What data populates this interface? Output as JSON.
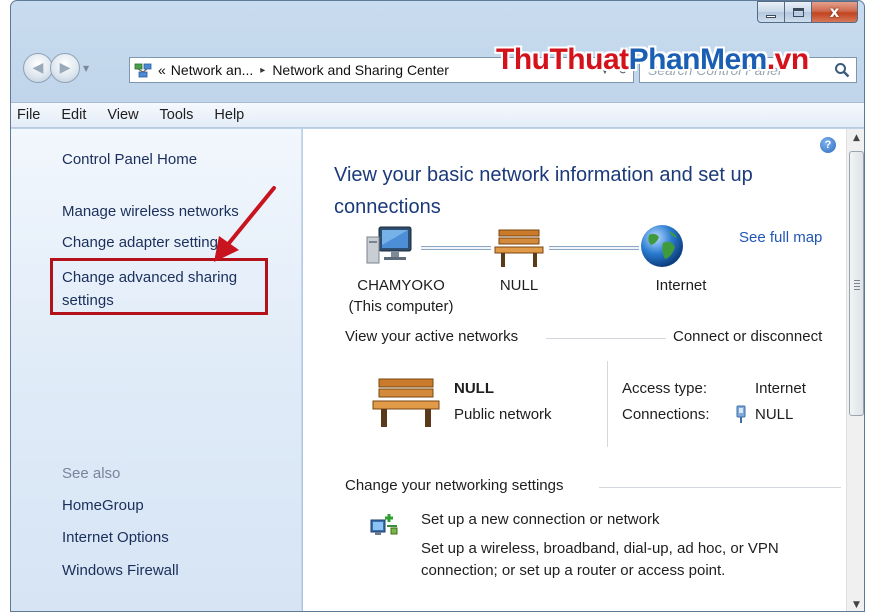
{
  "window": {
    "close_glyph": "x"
  },
  "address": {
    "chevron": "«",
    "crumb1": "Network an...",
    "separator": "▸",
    "crumb2": "Network and Sharing Center",
    "search_placeholder": "Search Control Panel"
  },
  "watermark": {
    "part1": "ThuThuat",
    "part2": "PhanMem",
    "part3": ".vn",
    "colors": {
      "red": "#d4121c",
      "blue": "#1a5fb4"
    }
  },
  "menu": {
    "items": [
      "File",
      "Edit",
      "View",
      "Tools",
      "Help"
    ]
  },
  "sidebar": {
    "home": "Control Panel Home",
    "links": [
      "Manage wireless networks",
      "Change adapter settings",
      "Change advanced sharing settings"
    ],
    "see_also_label": "See also",
    "see_also": [
      "HomeGroup",
      "Internet Options",
      "Windows Firewall"
    ],
    "highlight_color": "#b3121b"
  },
  "main": {
    "heading": "View your basic network information and set up connections",
    "see_full_map": "See full map",
    "map": {
      "computer_name": "CHAMYOKO",
      "computer_sub": "(This computer)",
      "network_name": "NULL",
      "internet_label": "Internet"
    },
    "active_networks": {
      "title": "View your active networks",
      "connect_link": "Connect or disconnect",
      "network_name": "NULL",
      "network_type": "Public network",
      "access_type_label": "Access type:",
      "access_type_value": "Internet",
      "connections_label": "Connections:",
      "connections_value": "NULL"
    },
    "change_settings": {
      "title": "Change your networking settings",
      "setup_link": "Set up a new connection or network",
      "setup_desc": "Set up a wireless, broadband, dial-up, ad hoc, or VPN connection; or set up a router or access point."
    }
  }
}
